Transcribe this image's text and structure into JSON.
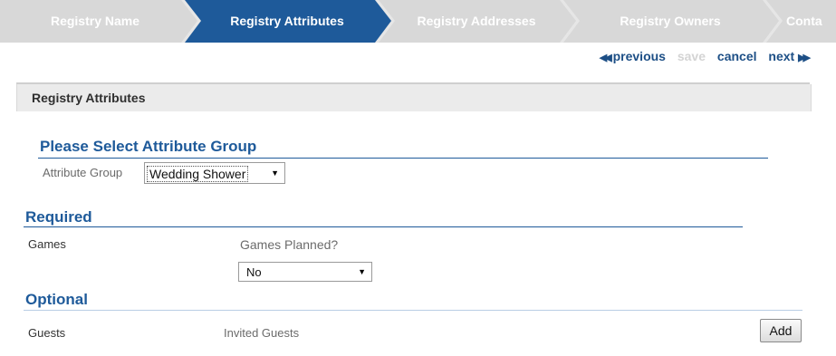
{
  "wizard": {
    "steps": [
      {
        "label": "Registry Name"
      },
      {
        "label": "Registry Attributes"
      },
      {
        "label": "Registry Addresses"
      },
      {
        "label": "Registry Owners"
      },
      {
        "label": "Conta"
      }
    ]
  },
  "nav": {
    "previous": "previous",
    "save": "save",
    "cancel": "cancel",
    "next": "next"
  },
  "panel": {
    "title": "Registry Attributes",
    "attr_group_heading": "Please Select Attribute Group",
    "attr_group_label": "Attribute Group",
    "attr_group_value": "Wedding Shower",
    "required_heading": "Required",
    "games_label": "Games",
    "games_question": "Games Planned?",
    "games_value": "No",
    "optional_heading": "Optional",
    "guests_label": "Guests",
    "guests_question": "Invited Guests",
    "add_button": "Add"
  },
  "colors": {
    "active_step": "#1e5a9a",
    "inactive_step": "#d7d7d7",
    "heading_blue": "#1e5a9a",
    "link": "#1d4f86"
  }
}
